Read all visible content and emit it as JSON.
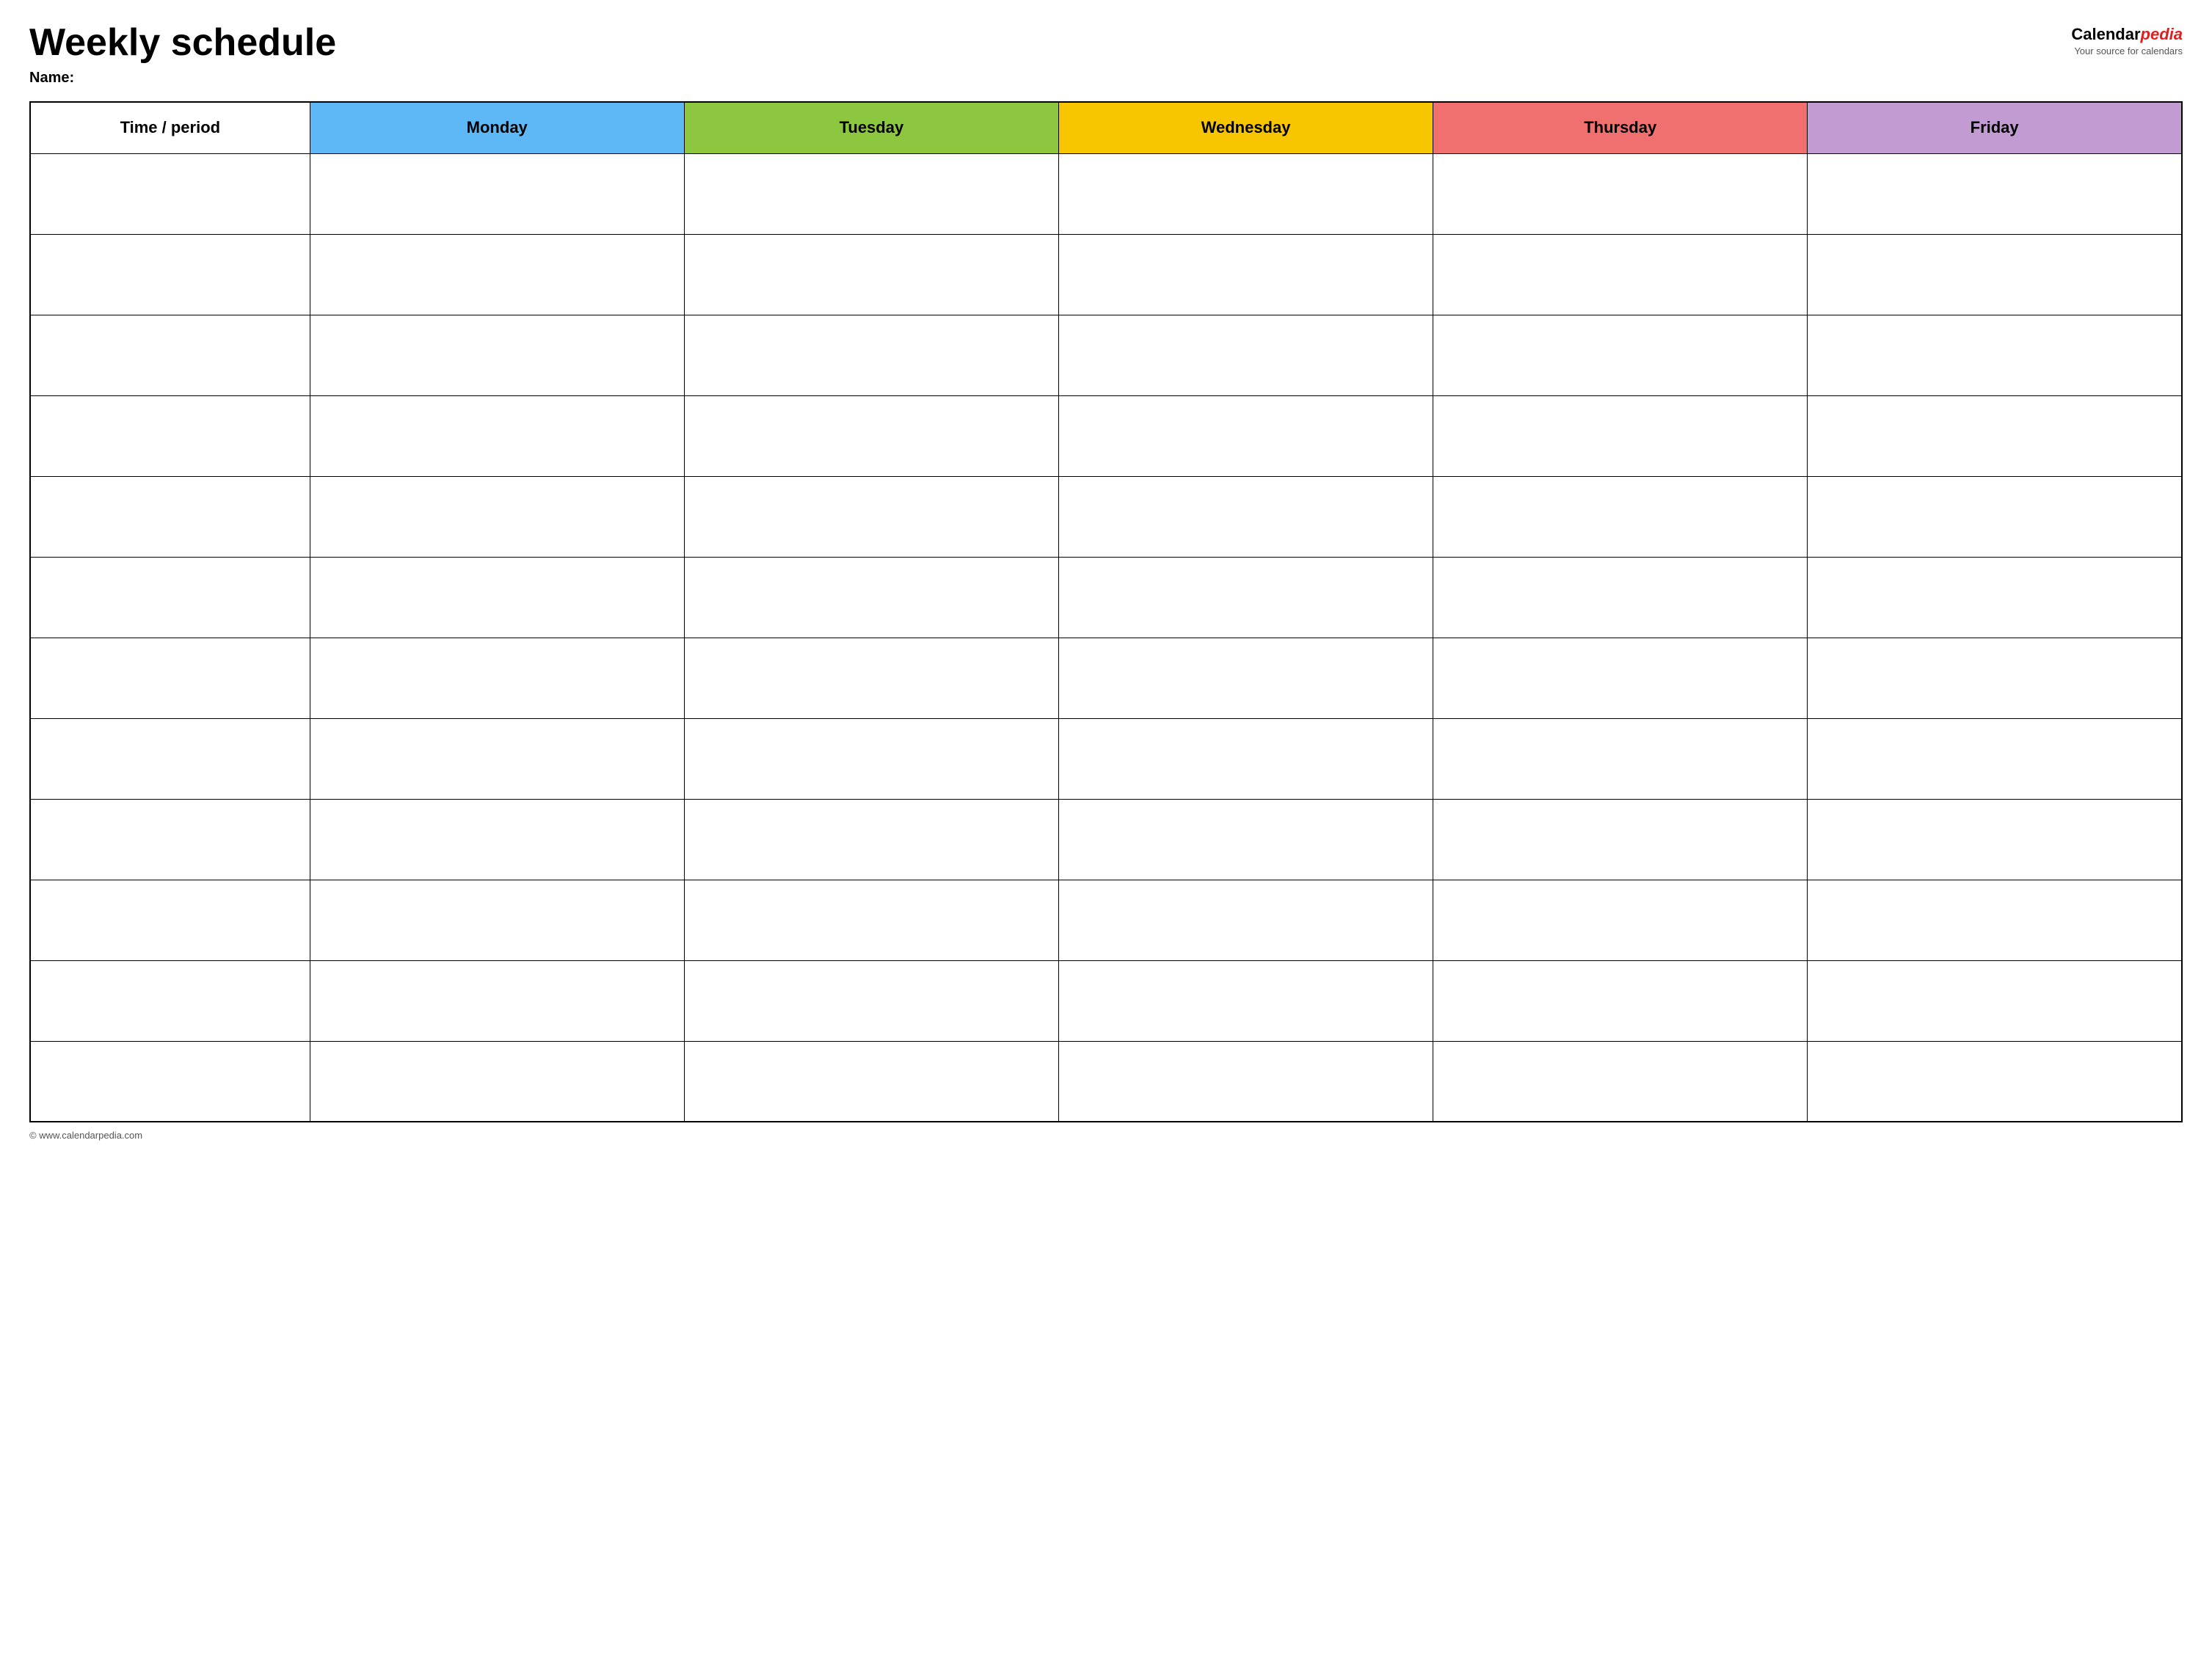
{
  "header": {
    "title": "Weekly schedule",
    "name_label": "Name:",
    "logo_text_calendar": "Calendar",
    "logo_text_pedia": "pedia",
    "logo_tagline": "Your source for calendars"
  },
  "table": {
    "columns": [
      {
        "id": "time",
        "label": "Time / period",
        "color": "col-time"
      },
      {
        "id": "monday",
        "label": "Monday",
        "color": "col-monday"
      },
      {
        "id": "tuesday",
        "label": "Tuesday",
        "color": "col-tuesday"
      },
      {
        "id": "wednesday",
        "label": "Wednesday",
        "color": "col-wednesday"
      },
      {
        "id": "thursday",
        "label": "Thursday",
        "color": "col-thursday"
      },
      {
        "id": "friday",
        "label": "Friday",
        "color": "col-friday"
      }
    ],
    "row_count": 12
  },
  "footer": {
    "copyright": "© www.calendarpedia.com"
  }
}
